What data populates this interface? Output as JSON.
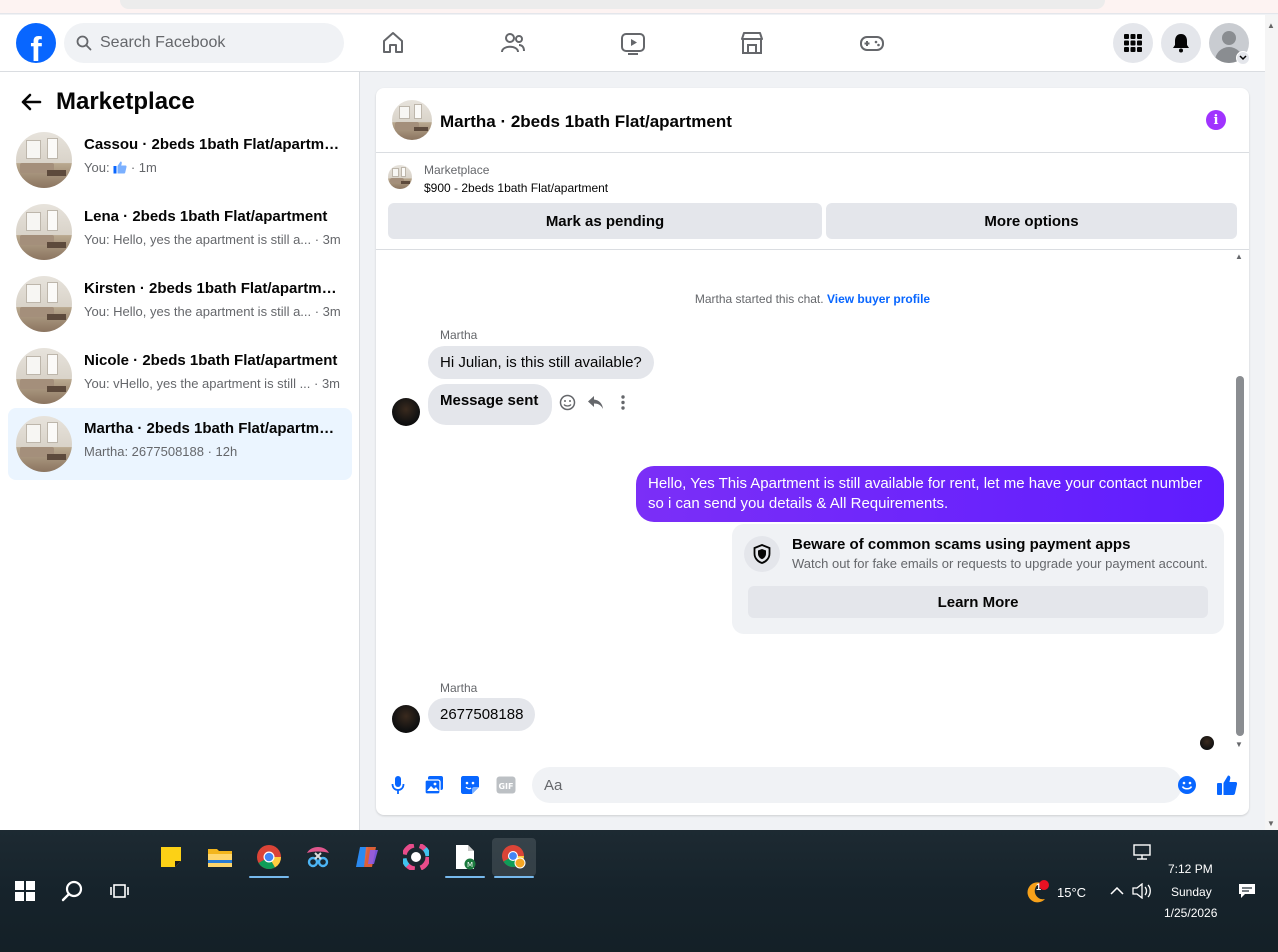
{
  "header": {
    "logo": "f",
    "search_placeholder": "Search Facebook",
    "nav": [
      "home-icon",
      "friends-icon",
      "video-icon",
      "marketplace-icon",
      "gaming-icon"
    ]
  },
  "sidebar": {
    "title": "Marketplace",
    "conversations": [
      {
        "name": "Cassou · 2beds 1bath Flat/apartment",
        "preview_prefix": "You:",
        "preview": "· 1m",
        "active": false
      },
      {
        "name": "Lena · 2beds 1bath Flat/apartment",
        "preview": "You: Hello, yes the apartment is still a... · 3m",
        "active": false
      },
      {
        "name": "Kirsten · 2beds 1bath Flat/apartment",
        "preview": "You: Hello, yes the apartment is still a... · 3m",
        "active": false
      },
      {
        "name": "Nicole · 2beds 1bath Flat/apartment",
        "preview": "You: vHello, yes the apartment is still ... · 3m",
        "active": false
      },
      {
        "name": "Martha · 2beds 1bath Flat/apartment",
        "preview": "Martha: 2677508188 · 12h",
        "active": true
      }
    ]
  },
  "chat": {
    "title": "Martha · 2beds 1bath Flat/apartment",
    "listing": {
      "source": "Marketplace",
      "price_line": "$900 - 2beds 1bath Flat/apartment",
      "pending_label": "Mark as pending",
      "more_label": "More options"
    },
    "system_text": "Martha started this chat.",
    "system_link": "View buyer profile",
    "messages": [
      {
        "sender": "Martha",
        "text": "Hi Julian, is this still available?"
      },
      {
        "text": "Message sent"
      },
      {
        "text": "Hello, Yes This Apartment is still available for rent, let me have your contact number so i can send you details & All Requirements."
      },
      {
        "sender": "Martha",
        "text": "2677508188"
      }
    ],
    "warning": {
      "title": "Beware of common scams using payment apps",
      "body": "Watch out for fake emails or requests to upgrade your payment account.",
      "button": "Learn More"
    },
    "composer_placeholder": "Aa"
  },
  "colors": {
    "brand": "#0866ff",
    "outgoing_bubble": "#6e1fff",
    "info": "#a033ff"
  },
  "taskbar": {
    "weather_temp": "15°C",
    "weather_badge": "1",
    "time": "7:12 PM",
    "day": "Sunday",
    "date": "1/25/2026"
  }
}
